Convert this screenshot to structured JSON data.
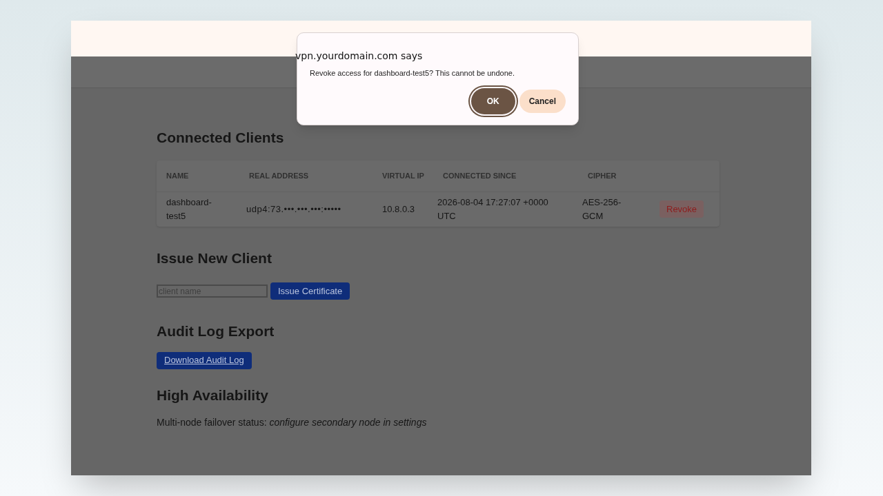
{
  "dialog": {
    "title": "vpn.yourdomain.com says",
    "message": "Revoke access for dashboard-test5? This cannot be undone.",
    "buttons": [
      {
        "label": "OK",
        "selected": true
      },
      {
        "label": "Cancel",
        "selected": false
      }
    ]
  },
  "clients": {
    "heading": "Connected Clients",
    "columns": [
      "NAME",
      "REAL ADDRESS",
      "VIRTUAL IP",
      "CONNECTED SINCE",
      "CIPHER"
    ],
    "rows": [
      {
        "name": "dashboard-test5",
        "real_address": "udp4:73.•••.•••.•••:•••••",
        "virtual_ip": "10.8.0.3",
        "connected_since": "2026-08-04 17:27:07 +0000 UTC",
        "cipher": "AES-256-GCM",
        "action": "Revoke"
      }
    ]
  },
  "issue": {
    "heading": "Issue New Client",
    "placeholder": "client name",
    "button": "Issue Certificate"
  },
  "audit": {
    "heading": "Audit Log Export",
    "button": "Download Audit Log"
  },
  "ha": {
    "heading": "High Availability",
    "label": "Multi-node failover status: ",
    "value": "configure secondary node in settings"
  }
}
